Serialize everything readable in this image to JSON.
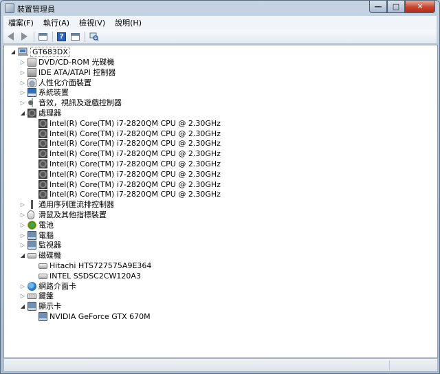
{
  "window": {
    "title": "裝置管理員",
    "controls": {
      "minimize": "—",
      "maximize": "□",
      "close": "✕"
    }
  },
  "menu": [
    {
      "label": "檔案(F)"
    },
    {
      "label": "執行(A)"
    },
    {
      "label": "檢視(V)"
    },
    {
      "label": "說明(H)"
    }
  ],
  "toolbar": {
    "buttons": [
      "back-arrow-icon",
      "forward-arrow-icon",
      "properties-window-icon",
      "help-icon",
      "view-window-icon",
      "scan-hardware-icon"
    ]
  },
  "tree": {
    "root": {
      "label": "GT683DX",
      "icon": "computer-icon",
      "expanded": true
    },
    "nodes": [
      {
        "label": "DVD/CD-ROM 光碟機",
        "level": 1,
        "icon": "disc-icon",
        "expanded": false
      },
      {
        "label": "IDE ATA/ATAPI 控制器",
        "level": 1,
        "icon": "ide-controller-icon",
        "expanded": false
      },
      {
        "label": "人性化介面裝置",
        "level": 1,
        "icon": "hid-icon",
        "expanded": false
      },
      {
        "label": "系統裝置",
        "level": 1,
        "icon": "system-device-icon",
        "expanded": false
      },
      {
        "label": "音效，視訊及遊戲控制器",
        "level": 1,
        "icon": "sound-icon",
        "expanded": false
      },
      {
        "label": "處理器",
        "level": 1,
        "icon": "processor-icon",
        "expanded": true
      },
      {
        "label": "Intel(R) Core(TM) i7-2820QM CPU @ 2.30GHz",
        "level": 2,
        "icon": "processor-icon"
      },
      {
        "label": "Intel(R) Core(TM) i7-2820QM CPU @ 2.30GHz",
        "level": 2,
        "icon": "processor-icon"
      },
      {
        "label": "Intel(R) Core(TM) i7-2820QM CPU @ 2.30GHz",
        "level": 2,
        "icon": "processor-icon"
      },
      {
        "label": "Intel(R) Core(TM) i7-2820QM CPU @ 2.30GHz",
        "level": 2,
        "icon": "processor-icon"
      },
      {
        "label": "Intel(R) Core(TM) i7-2820QM CPU @ 2.30GHz",
        "level": 2,
        "icon": "processor-icon"
      },
      {
        "label": "Intel(R) Core(TM) i7-2820QM CPU @ 2.30GHz",
        "level": 2,
        "icon": "processor-icon"
      },
      {
        "label": "Intel(R) Core(TM) i7-2820QM CPU @ 2.30GHz",
        "level": 2,
        "icon": "processor-icon"
      },
      {
        "label": "Intel(R) Core(TM) i7-2820QM CPU @ 2.30GHz",
        "level": 2,
        "icon": "processor-icon"
      },
      {
        "label": "通用序列匯流排控制器",
        "level": 1,
        "icon": "usb-icon",
        "expanded": false
      },
      {
        "label": "滑鼠及其他指標裝置",
        "level": 1,
        "icon": "mouse-icon",
        "expanded": false
      },
      {
        "label": "電池",
        "level": 1,
        "icon": "battery-icon",
        "expanded": false
      },
      {
        "label": "電腦",
        "level": 1,
        "icon": "computer-icon",
        "expanded": false
      },
      {
        "label": "監視器",
        "level": 1,
        "icon": "monitor-icon",
        "expanded": false
      },
      {
        "label": "磁碟機",
        "level": 1,
        "icon": "disk-drive-icon",
        "expanded": true
      },
      {
        "label": "Hitachi HTS727575A9E364",
        "level": 2,
        "icon": "disk-drive-icon"
      },
      {
        "label": "INTEL SSDSC2CW120A3",
        "level": 2,
        "icon": "disk-drive-icon"
      },
      {
        "label": "網路介面卡",
        "level": 1,
        "icon": "network-adapter-icon",
        "expanded": false
      },
      {
        "label": "鍵盤",
        "level": 1,
        "icon": "keyboard-icon",
        "expanded": false
      },
      {
        "label": "顯示卡",
        "level": 1,
        "icon": "display-adapter-icon",
        "expanded": true
      },
      {
        "label": "NVIDIA GeForce GTX 670M",
        "level": 2,
        "icon": "display-adapter-icon"
      }
    ]
  }
}
